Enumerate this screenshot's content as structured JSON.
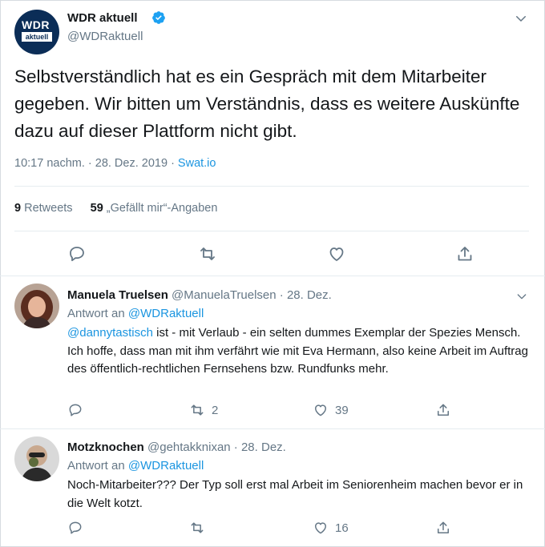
{
  "main_tweet": {
    "name": "WDR aktuell",
    "handle": "@WDRaktuell",
    "avatar_text": "WDR",
    "avatar_subtext": "aktuell",
    "text": "Selbstverständlich hat es ein Gespräch mit dem Mitarbeiter gegeben. Wir bitten um Verständnis, dass es weitere Auskünfte dazu auf dieser Plattform nicht gibt.",
    "timestamp": "10:17 nachm. · 28. Dez. 2019 · ",
    "source": "Swat.io",
    "retweet_count": "9",
    "retweet_label": "Retweets",
    "like_count": "59",
    "like_label": "„Gefällt mir“-Angaben"
  },
  "replies": [
    {
      "name": "Manuela Truelsen",
      "handle_date": "@ManuelaTruelsen · 28. Dez.",
      "reply_to_label": "Antwort an",
      "reply_to_handle": "@WDRaktuell",
      "mention": "@dannytastisch",
      "text": " ist - mit Verlaub - ein selten dummes Exemplar der Spezies Mensch. Ich hoffe, dass man mit ihm verfährt wie mit Eva Hermann, also keine Arbeit im Auftrag des öffentlich-rechtlichen Fernsehens bzw. Rundfunks mehr.",
      "retweets": "2",
      "likes": "39"
    },
    {
      "name": "Motzknochen",
      "handle_date": "@gehtakknixan · 28. Dez.",
      "reply_to_label": "Antwort an",
      "reply_to_handle": "@WDRaktuell",
      "text": "Noch-Mitarbeiter??? Der Typ soll erst mal Arbeit im Seniorenheim machen bevor er in die Welt kotzt.",
      "retweets": "",
      "likes": "16"
    }
  ],
  "colors": {
    "text": "#14171a",
    "secondary": "#657786",
    "link": "#1b95e0",
    "divider": "#e6ecf0",
    "avatar_bg": "#0b2d57"
  }
}
